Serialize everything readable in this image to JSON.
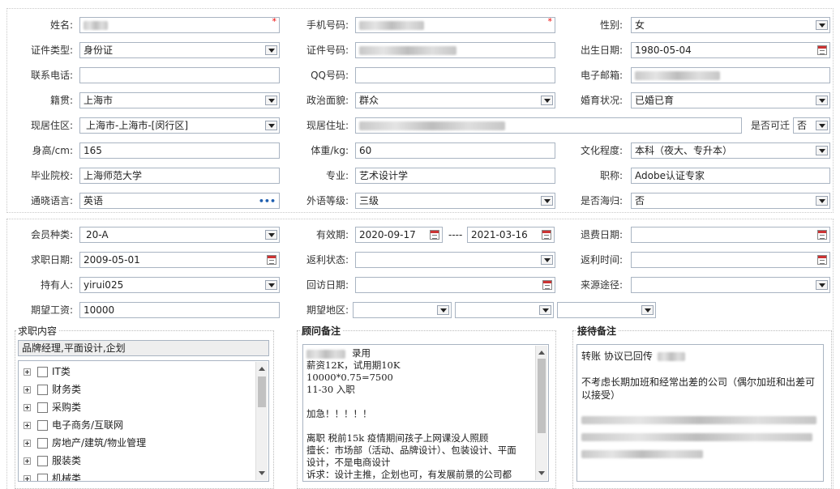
{
  "personal": {
    "name_label": "姓名:",
    "mobile_label": "手机号码:",
    "gender_label": "性别:",
    "gender_value": "女",
    "id_type_label": "证件类型:",
    "id_type_value": "身份证",
    "id_no_label": "证件号码:",
    "birth_label": "出生日期:",
    "birth_value": "1980-05-04",
    "phone_label": "联系电话:",
    "qq_label": "QQ号码:",
    "email_label": "电子邮箱:",
    "native_label": "籍贯:",
    "native_value": "上海市",
    "politics_label": "政治面貌:",
    "politics_value": "群众",
    "marital_label": "婚育状况:",
    "marital_value": "已婚已育",
    "residence_label": "现居住区:",
    "residence_value": "上海市-上海市-[闵行区]",
    "address_label": "现居住址:",
    "relocate_label": "是否可迁",
    "relocate_value": "否",
    "height_label": "身高/cm:",
    "height_value": "165",
    "weight_label": "体重/kg:",
    "weight_value": "60",
    "education_label": "文化程度:",
    "education_value": "本科（夜大、专升本）",
    "school_label": "毕业院校:",
    "school_value": "上海师范大学",
    "major_label": "专业:",
    "major_value": "艺术设计学",
    "title_label": "职称:",
    "title_value": "Adobe认证专家",
    "language_label": "通晓语言:",
    "language_value": "英语",
    "language_more": "•••",
    "foreign_level_label": "外语等级:",
    "foreign_level_value": "三级",
    "returnee_label": "是否海归:",
    "returnee_value": "否"
  },
  "membership": {
    "type_label": "会员种类:",
    "type_value": "20-A",
    "validity_label": "有效期:",
    "validity_start": "2020-09-17",
    "validity_sep": "----",
    "validity_end": "2021-03-16",
    "refund_date_label": "退费日期:",
    "apply_date_label": "求职日期:",
    "apply_date_value": "2009-05-01",
    "rebate_status_label": "返利状态:",
    "rebate_time_label": "返利时间:",
    "holder_label": "持有人:",
    "holder_value": "yirui025",
    "visit_date_label": "回访日期:",
    "source_label": "来源途径:",
    "salary_label": "期望工资:",
    "salary_value": "10000",
    "area_label": "期望地区:"
  },
  "job_content": {
    "title": "求职内容",
    "selected": "品牌经理,平面设计,企划",
    "tree": [
      "IT类",
      "财务类",
      "采购类",
      "电子商务/互联网",
      "房地产/建筑/物业管理",
      "服装类",
      "机械类"
    ]
  },
  "consultant_note": {
    "title": "顾问备注",
    "lines": [
      "录用",
      "薪资12K，试用期10K",
      "10000*0.75=7500",
      "11-30 入职",
      "",
      "加急！！！！！",
      "",
      "离职 税前15k 疫情期间孩子上网课没人照顾",
      "擅长：市场部（活动、品牌设计）、包装设计、平面",
      "设计，不是电商设计",
      "诉求：设计主推，企划也可，有发展前景的公司都"
    ]
  },
  "reception_note": {
    "title": "接待备注",
    "line1": "转账 协议已回传",
    "line2": "不考虑长期加班和经常出差的公司（偶尔加班和出差可以接受）"
  },
  "colors": {
    "required": "#ee0000",
    "border": "#a9b4c2",
    "more_dots": "#1f5fb0"
  }
}
